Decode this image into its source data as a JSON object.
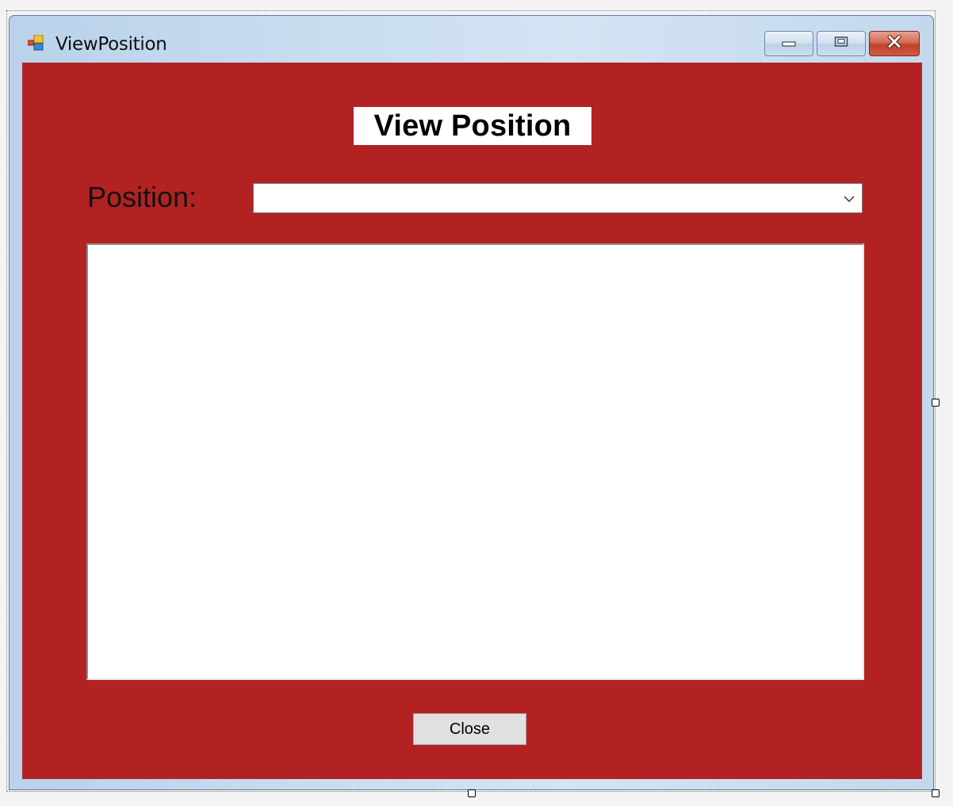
{
  "window": {
    "title": "ViewPosition",
    "app_icon": "form-icon",
    "caption_buttons": {
      "minimize": "minimize-icon",
      "maximize": "maximize-icon",
      "close": "close-icon"
    }
  },
  "form": {
    "background_color": "#b22222",
    "heading": "View Position",
    "position_label": "Position:",
    "position_combo": {
      "selected_value": "",
      "dropdown_icon": "chevron-down-icon"
    },
    "results_list": {
      "items": []
    },
    "close_button_label": "Close"
  }
}
